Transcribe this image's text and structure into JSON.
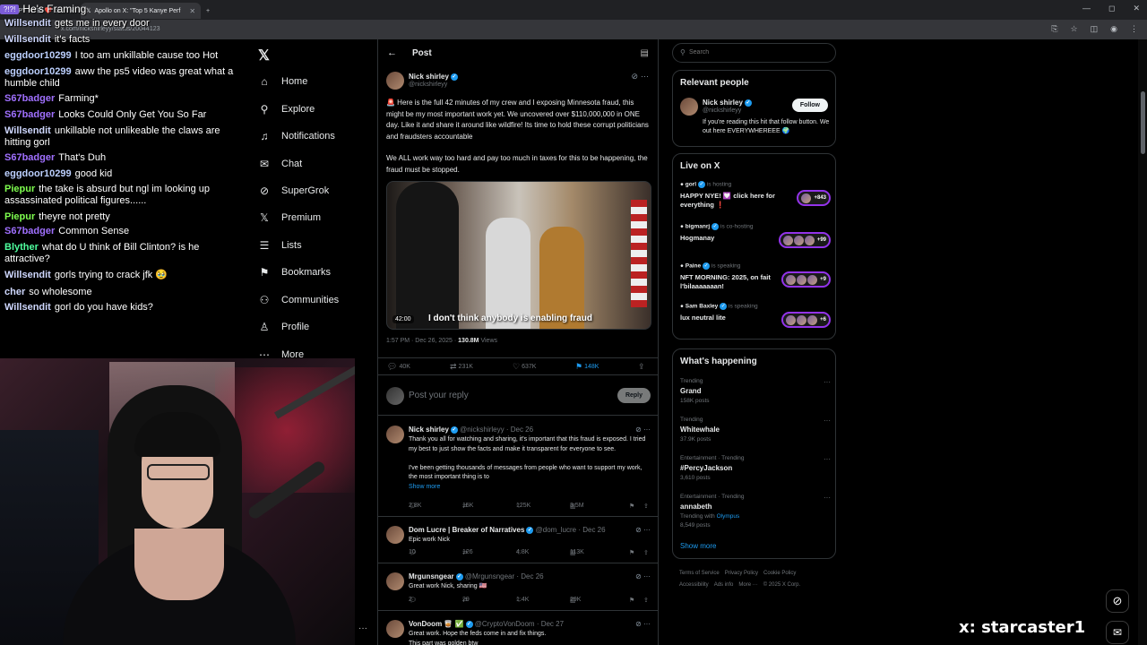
{
  "browser": {
    "tabs": [
      {
        "label": "HAPPY NYE! ❤️ cli",
        "active": false
      },
      {
        "label": "Apollo on X: \"Top 5 Kanye Perf",
        "active": true
      }
    ],
    "url": "x.com/nickshirleyy/status/20044123",
    "controls": [
      "—",
      "◻",
      "✕"
    ]
  },
  "chat": {
    "header_badge": "?!?!",
    "header_title": "He's Framing",
    "messages": [
      {
        "user": "Willsendit",
        "color": "#cfd8ff",
        "text": "gets me in every door"
      },
      {
        "user": "Willsendit",
        "color": "#cfd8ff",
        "text": "it's facts"
      },
      {
        "user": "eggdoor10299",
        "color": "#bcd0ff",
        "text": "I too am unkillable cause too Hot"
      },
      {
        "user": "eggdoor10299",
        "color": "#bcd0ff",
        "text": "aww the ps5 video was great what a humble child"
      },
      {
        "user": "S67badger",
        "color": "#a070ff",
        "text": "Farming*"
      },
      {
        "user": "S67badger",
        "color": "#a070ff",
        "text": "Looks Could Only Get You So Far"
      },
      {
        "user": "Willsendit",
        "color": "#cfd8ff",
        "text": "unkillable not unlikeable the claws are hitting gorl"
      },
      {
        "user": "S67badger",
        "color": "#a070ff",
        "text": "That's Duh"
      },
      {
        "user": "eggdoor10299",
        "color": "#bcd0ff",
        "text": "good kid"
      },
      {
        "user": "Piepur",
        "color": "#7fff4f",
        "text": "the take is absurd but ngl im looking up assassinated political figures......"
      },
      {
        "user": "Piepur",
        "color": "#7fff4f",
        "text": "theyre not pretty"
      },
      {
        "user": "S67badger",
        "color": "#a070ff",
        "text": "Common Sense"
      },
      {
        "user": "Blyther",
        "color": "#4fff9f",
        "text": "what do U think of Bill Clinton? is he attractive?"
      },
      {
        "user": "Willsendit",
        "color": "#cfd8ff",
        "text": "gorls trying to crack jfk 🥹"
      },
      {
        "user": "cher",
        "color": "#cfd8ff",
        "text": "so wholesome"
      },
      {
        "user": "Willsendit",
        "color": "#cfd8ff",
        "text": "gorl do you have kids?"
      }
    ]
  },
  "nav": {
    "items": [
      {
        "label": "Home",
        "icon": "⌂"
      },
      {
        "label": "Explore",
        "icon": "⚲"
      },
      {
        "label": "Notifications",
        "icon": "♫"
      },
      {
        "label": "Chat",
        "icon": "✉"
      },
      {
        "label": "SuperGrok",
        "icon": "⊘"
      },
      {
        "label": "Premium",
        "icon": "𝕏"
      },
      {
        "label": "Lists",
        "icon": "☰"
      },
      {
        "label": "Bookmarks",
        "icon": "⚑"
      },
      {
        "label": "Communities",
        "icon": "⚇"
      },
      {
        "label": "Profile",
        "icon": "♙"
      },
      {
        "label": "More",
        "icon": "⋯"
      }
    ]
  },
  "post": {
    "header_title": "Post",
    "author_name": "Nick shirley",
    "author_handle": "@nickshirleyy",
    "text1": "🚨 Here is the full 42 minutes of my crew and I exposing Minnesota fraud, this might be my most important work yet. We uncovered over $110,000,000 in ONE day. Like it and share it around like wildfire! Its time to hold these corrupt politicians and fraudsters accountable",
    "text2": "We ALL work way too hard and pay too much in taxes for this to be happening, the fraud must be stopped.",
    "video_duration": "42:00",
    "video_caption": "I don't think anybody is enabling fraud",
    "meta_time": "1:57 PM · Dec 26, 2025 · ",
    "meta_views": "130.8M",
    "meta_views_label": " Views",
    "stats": {
      "replies": "40K",
      "reposts": "231K",
      "likes": "637K",
      "bookmarks": "148K"
    },
    "reply_placeholder": "Post your reply",
    "reply_button": "Reply"
  },
  "replies": [
    {
      "name": "Nick shirley",
      "handle": "@nickshirleyy · Dec 26",
      "text": "Thank you all for watching and sharing, it's important that this fraud is exposed. I tried my best to just show the facts and make it transparent for everyone to see.\n\nI've been getting thousands of messages from people who want to support my work, the most important thing is to",
      "show_more": "Show more",
      "stats": {
        "replies": "2.8K",
        "reposts": "15K",
        "likes": "125K",
        "views": "3.5M"
      }
    },
    {
      "name": "Dom Lucre | Breaker of Narratives",
      "handle": "@dom_lucre · Dec 26",
      "text": "Epic work Nick",
      "show_more": "",
      "stats": {
        "replies": "10",
        "reposts": "126",
        "likes": "4.8K",
        "views": "113K"
      }
    },
    {
      "name": "Mrgunsngear",
      "handle": "@Mrgunsngear · Dec 26",
      "text": "Great work Nick, sharing 🇺🇸",
      "show_more": "",
      "stats": {
        "replies": "2",
        "reposts": "29",
        "likes": "1.4K",
        "views": "29K"
      }
    },
    {
      "name": "VonDoom 🥃 ✅",
      "handle": "@CryptoVonDoom · Dec 27",
      "text": "Great work. Hope the feds come in and fix things.\nThis part was golden btw",
      "show_more": "",
      "stats": {
        "replies": "",
        "reposts": "",
        "likes": "",
        "views": ""
      }
    }
  ],
  "right": {
    "search_placeholder": "Search",
    "relevant_title": "Relevant people",
    "rp_name": "Nick shirley",
    "rp_handle": "@nickshirleyy",
    "rp_follow": "Follow",
    "rp_bio": "If you're reading this hit that follow button. We out here EVERYWHEREEE 🌍",
    "live_title": "Live on X",
    "live": [
      {
        "host": "gorl",
        "status": "is hosting",
        "title": "HAPPY NYE! 💟 click here for everything ❗",
        "count": "+843"
      },
      {
        "host": "bigmanrj",
        "status": "is co-hosting",
        "title": "Hogmanay",
        "count": "+99"
      },
      {
        "host": "Paine",
        "status": "is speaking",
        "title": "NFT MORNING: 2025, on fait l'bilaaaaaaan!",
        "count": "+9"
      },
      {
        "host": "Sam Baxley",
        "status": "is speaking",
        "title": "lux neutral lite",
        "count": "+6"
      }
    ],
    "happening_title": "What's happening",
    "trends": [
      {
        "cat": "Trending",
        "name": "Grand",
        "count": "158K posts"
      },
      {
        "cat": "Trending",
        "name": "Whitewhale",
        "count": "37.9K posts"
      },
      {
        "cat": "Entertainment · Trending",
        "name": "#PercyJackson",
        "count": "3,610 posts"
      },
      {
        "cat": "Entertainment · Trending",
        "name": "annabeth",
        "count": "8,549 posts",
        "with": "Trending with ",
        "with_link": "Olympus"
      }
    ],
    "show_more": "Show more",
    "footer": [
      "Terms of Service",
      "Privacy Policy",
      "Cookie Policy",
      "Accessibility",
      "Ads info",
      "More ···",
      "© 2025 X Corp."
    ]
  },
  "overlay": {
    "streamer_tag": "x: starcaster1"
  }
}
